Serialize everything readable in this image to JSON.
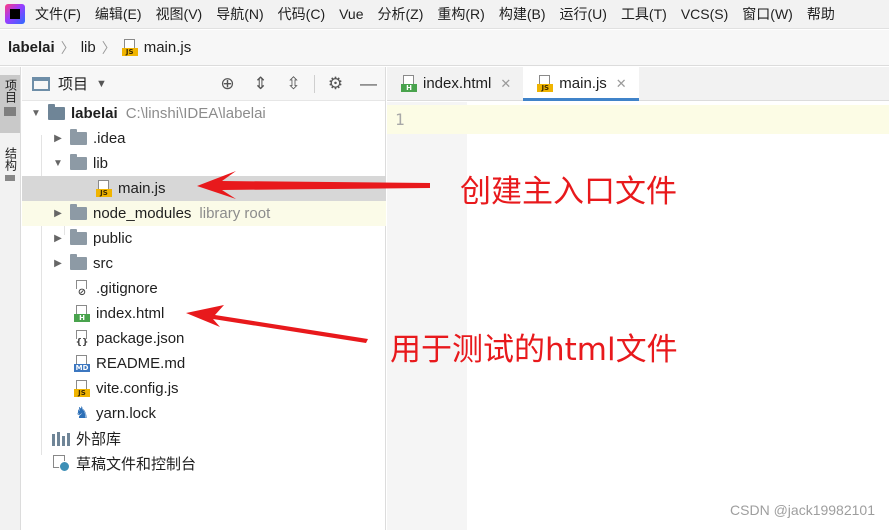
{
  "menu": [
    "文件(F)",
    "编辑(E)",
    "视图(V)",
    "导航(N)",
    "代码(C)",
    "Vue",
    "分析(Z)",
    "重构(R)",
    "构建(B)",
    "运行(U)",
    "工具(T)",
    "VCS(S)",
    "窗口(W)",
    "帮助"
  ],
  "breadcrumb": {
    "project": "labelai",
    "folder": "lib",
    "file": "main.js"
  },
  "toolstrip": {
    "project_tab": "项目",
    "structure_tab": "结构"
  },
  "project_panel": {
    "title": "项目",
    "tools": [
      "crosshair-icon",
      "expand-all-icon",
      "collapse-all-icon",
      "gear-icon",
      "minimize-icon"
    ],
    "root": {
      "name": "labelai",
      "path": "C:\\linshi\\IDEA\\labelai"
    },
    "items": [
      {
        "name": ".idea",
        "kind": "folder"
      },
      {
        "name": "lib",
        "kind": "folder"
      },
      {
        "name": "main.js",
        "kind": "js"
      },
      {
        "name": "node_modules",
        "kind": "folder",
        "hint": "library root"
      },
      {
        "name": "public",
        "kind": "folder"
      },
      {
        "name": "src",
        "kind": "folder"
      },
      {
        "name": ".gitignore",
        "kind": "git"
      },
      {
        "name": "index.html",
        "kind": "html"
      },
      {
        "name": "package.json",
        "kind": "json"
      },
      {
        "name": "README.md",
        "kind": "md"
      },
      {
        "name": "vite.config.js",
        "kind": "js"
      },
      {
        "name": "yarn.lock",
        "kind": "yarn"
      }
    ],
    "external_libs": "外部库",
    "scratches": "草稿文件和控制台"
  },
  "editor": {
    "tabs": [
      {
        "label": "index.html",
        "icon": "html"
      },
      {
        "label": "main.js",
        "icon": "js"
      }
    ],
    "line_number": "1"
  },
  "annotations": {
    "main_entry": "创建主入口文件",
    "test_html": "用于测试的html文件",
    "color": "#e8191c"
  },
  "watermark": "CSDN @jack19982101"
}
